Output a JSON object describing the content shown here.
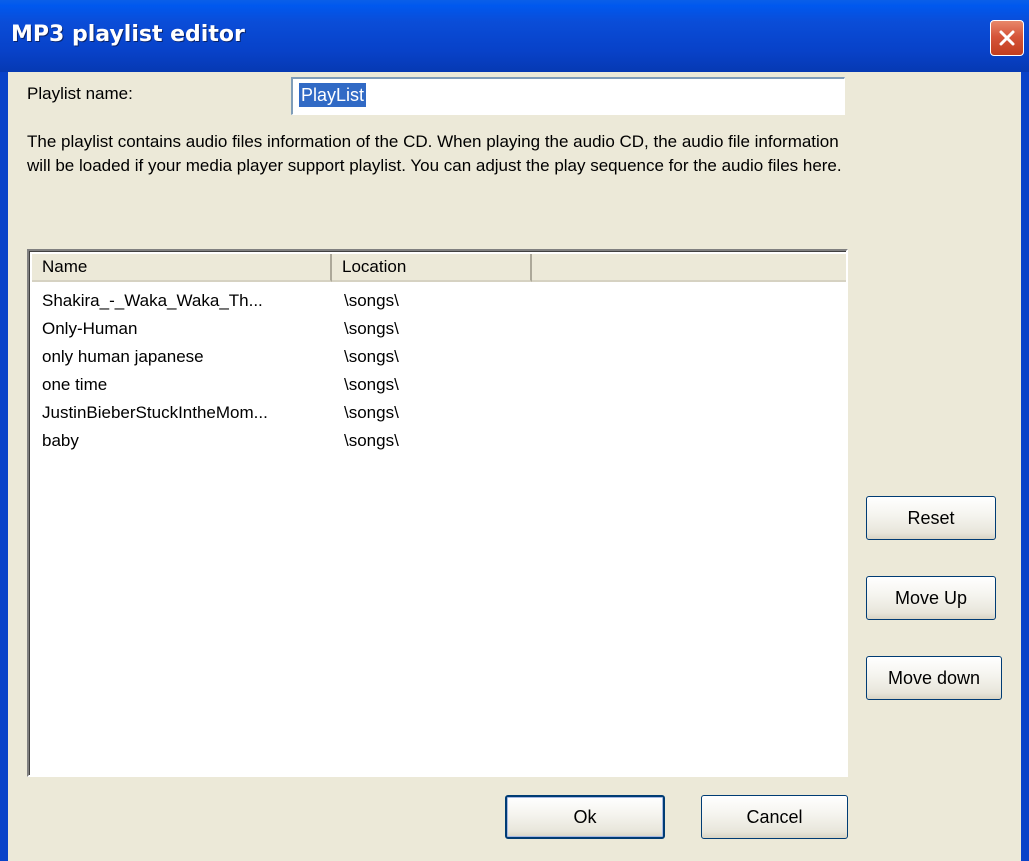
{
  "window": {
    "title": "MP3 playlist editor"
  },
  "playlist_name": {
    "label": "Playlist name:",
    "value": "PlayList"
  },
  "description": "The playlist contains audio files information of the CD. When playing the audio CD, the audio file information will be loaded if your media player support playlist. You can adjust the play sequence for the audio files here.",
  "table": {
    "columns": [
      "Name",
      "Location",
      ""
    ],
    "rows": [
      {
        "name": "Shakira_-_Waka_Waka_Th...",
        "location": "\\songs\\"
      },
      {
        "name": "Only-Human",
        "location": "\\songs\\"
      },
      {
        "name": "only human japanese",
        "location": "\\songs\\"
      },
      {
        "name": "one time",
        "location": "\\songs\\"
      },
      {
        "name": "JustinBieberStuckIntheMom...",
        "location": "\\songs\\"
      },
      {
        "name": "baby",
        "location": "\\songs\\"
      }
    ]
  },
  "buttons": {
    "reset": "Reset",
    "move_up": "Move Up",
    "move_down": "Move down",
    "ok": "Ok",
    "cancel": "Cancel"
  },
  "icons": {
    "close": "close-icon"
  },
  "colors": {
    "titlebar": "#0842C9",
    "close_button": "#D6553A",
    "selection": "#316AC5",
    "dialog_bg": "#ECE9D8"
  }
}
